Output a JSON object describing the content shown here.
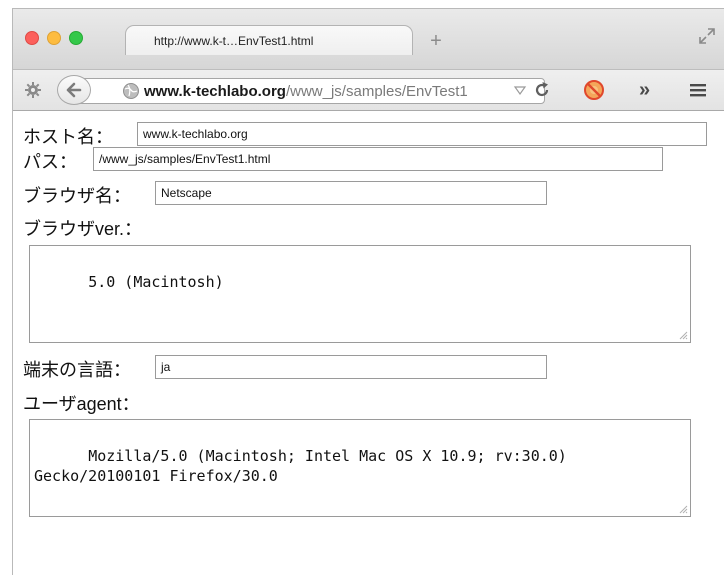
{
  "browser": {
    "tab_title": "http://www.k-t…EnvTest1.html",
    "new_tab_label": "+",
    "url_host": "www.k-techlabo.org",
    "url_path": "/www_js/samples/EnvTest1",
    "overflow_label": "»",
    "icons": [
      "gear-icon",
      "back-arrow-icon",
      "globe-icon",
      "dropdown-icon",
      "reload-icon",
      "addon-icon",
      "menu-icon",
      "fullscreen-icon"
    ]
  },
  "form": {
    "host": {
      "label": "ホスト名：",
      "value": "www.k-techlabo.org"
    },
    "path": {
      "label": "パス：",
      "value": "/www_js/samples/EnvTest1.html"
    },
    "browser_name": {
      "label": "ブラウザ名：",
      "value": "Netscape"
    },
    "browser_ver": {
      "label": "ブラウザver.：",
      "value": "5.0 (Macintosh)"
    },
    "language": {
      "label": "端末の言語：",
      "value": "ja"
    },
    "user_agent": {
      "label": "ユーザagent：",
      "value": "Mozilla/5.0 (Macintosh; Intel Mac OS X 10.9; rv:30.0)\nGecko/20100101 Firefox/30.0"
    }
  },
  "colors": {
    "close": "#fc605c",
    "minimize": "#fdbc40",
    "maximize": "#34c84a"
  }
}
